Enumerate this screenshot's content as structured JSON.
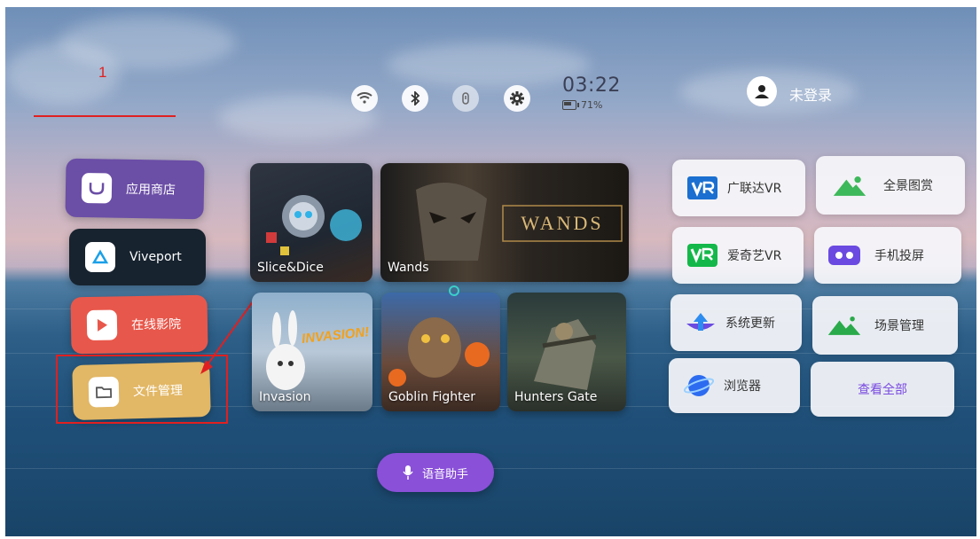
{
  "status_bar": {
    "icons": [
      "wifi-icon",
      "bluetooth-icon",
      "hand-tracking-icon",
      "settings-icon"
    ],
    "time": "03:22",
    "battery": "71%"
  },
  "user": {
    "login_label": "未登录"
  },
  "left_menu": {
    "items": [
      {
        "label": "应用商店",
        "icon": "store-icon",
        "color": "#6b4ea6"
      },
      {
        "label": "Viveport",
        "icon": "viveport-icon",
        "color": "#17232f"
      },
      {
        "label": "在线影院",
        "icon": "play-icon",
        "color": "#e8574b"
      },
      {
        "label": "文件管理",
        "icon": "folder-icon",
        "color": "#e2b765"
      }
    ]
  },
  "games": [
    {
      "label": "Slice&Dice"
    },
    {
      "label": "Wands",
      "logo_text": "WANDS"
    },
    {
      "label": "Invasion",
      "logo_text": "INVASION!"
    },
    {
      "label": "Goblin Fighter"
    },
    {
      "label": "Hunters Gate"
    }
  ],
  "right_apps": {
    "items": [
      {
        "label": "广联达VR",
        "icon": "vr-logo-icon"
      },
      {
        "label": "全景图赏",
        "icon": "mountain-icon"
      },
      {
        "label": "爱奇艺VR",
        "icon": "iqiyi-vr-icon"
      },
      {
        "label": "手机投屏",
        "icon": "screen-cast-icon"
      },
      {
        "label": "系统更新",
        "icon": "update-icon"
      },
      {
        "label": "场景管理",
        "icon": "scene-icon"
      },
      {
        "label": "浏览器",
        "icon": "browser-icon"
      },
      {
        "label": "查看全部",
        "icon": ""
      }
    ]
  },
  "voice_assistant": {
    "label": "语音助手"
  },
  "annotation": {
    "number": "1"
  },
  "colors": {
    "annotation_red": "#e02020",
    "voice_purple": "#8a50d8"
  }
}
